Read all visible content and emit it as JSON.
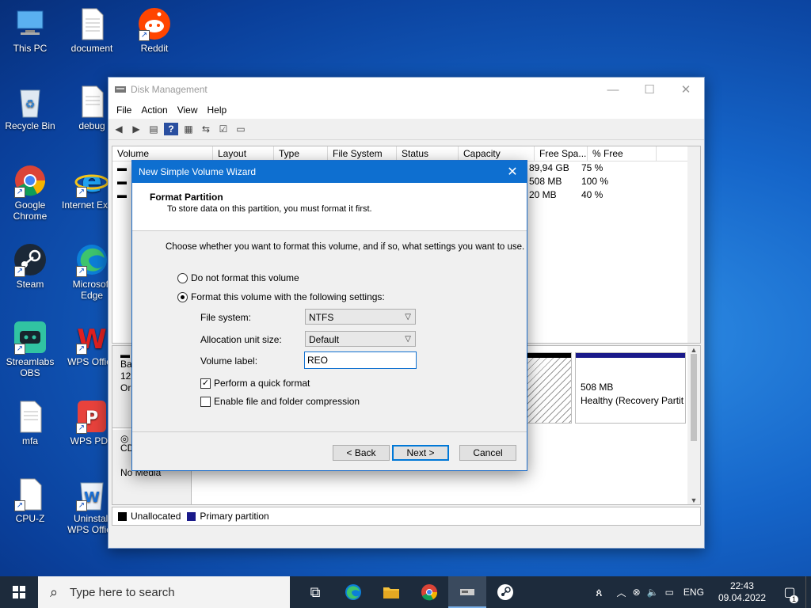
{
  "desktop_icons": [
    {
      "label": "This PC",
      "icon": "monitor-icon"
    },
    {
      "label": "document",
      "icon": "document-icon"
    },
    {
      "label": "Reddit",
      "icon": "reddit-icon"
    },
    {
      "label": "Recycle Bin",
      "icon": "recycle-bin-icon"
    },
    {
      "label": "debug",
      "icon": "document-icon"
    },
    {
      "label": "Google Chrome",
      "icon": "chrome-icon"
    },
    {
      "label": "Internet Explorer",
      "icon": "ie-icon"
    },
    {
      "label": "Steam",
      "icon": "steam-icon"
    },
    {
      "label": "Microsoft Edge",
      "icon": "edge-icon"
    },
    {
      "label": "Streamlabs OBS",
      "icon": "streamlabs-icon"
    },
    {
      "label": "WPS Office",
      "icon": "wps-icon"
    },
    {
      "label": "mfa",
      "icon": "document-icon"
    },
    {
      "label": "WPS PDF",
      "icon": "wps-pdf-icon"
    },
    {
      "label": "CPU-Z",
      "icon": "document-icon"
    },
    {
      "label": "Uninstall WPS Office",
      "icon": "uninstall-icon"
    }
  ],
  "disk_management": {
    "title": "Disk Management",
    "menu": [
      "File",
      "Action",
      "View",
      "Help"
    ],
    "columns": [
      "Volume",
      "Layout",
      "Type",
      "File System",
      "Status",
      "Capacity",
      "Free Spa...",
      "% Free"
    ],
    "rows": [
      {
        "free": "89,94 GB",
        "pct": "75 %"
      },
      {
        "free": "508 MB",
        "pct": "100 %"
      },
      {
        "free": "20 MB",
        "pct": "40 %"
      }
    ],
    "graph": {
      "disk0_label_1": "Ba",
      "disk0_label_2": "12",
      "disk0_label_3": "Or",
      "cd_label": "CD",
      "no_media": "No Media",
      "recovery_size": "508 MB",
      "recovery_status": "Healthy (Recovery Partit"
    },
    "legend": {
      "unallocated": "Unallocated",
      "primary": "Primary partition"
    }
  },
  "wizard": {
    "title": "New Simple Volume Wizard",
    "heading": "Format Partition",
    "subheading": "To store data on this partition, you must format it first.",
    "instruction": "Choose whether you want to format this volume, and if so, what settings you want to use.",
    "opt_no_format": "Do not format this volume",
    "opt_format": "Format this volume with the following settings:",
    "file_system_label": "File system:",
    "file_system_value": "NTFS",
    "alloc_label": "Allocation unit size:",
    "alloc_value": "Default",
    "volume_label_label": "Volume label:",
    "volume_label_value": "REO",
    "quick_format": "Perform a quick format",
    "compression": "Enable file and folder compression",
    "back": "< Back",
    "next": "Next >",
    "cancel": "Cancel"
  },
  "taskbar": {
    "search_placeholder": "Type here to search",
    "language": "ENG",
    "time": "22:43",
    "date": "09.04.2022",
    "notifications": "1"
  },
  "colors": {
    "unallocated": "#000000",
    "primary": "#1a1a8a",
    "wizard_title": "#0e6fd0"
  }
}
